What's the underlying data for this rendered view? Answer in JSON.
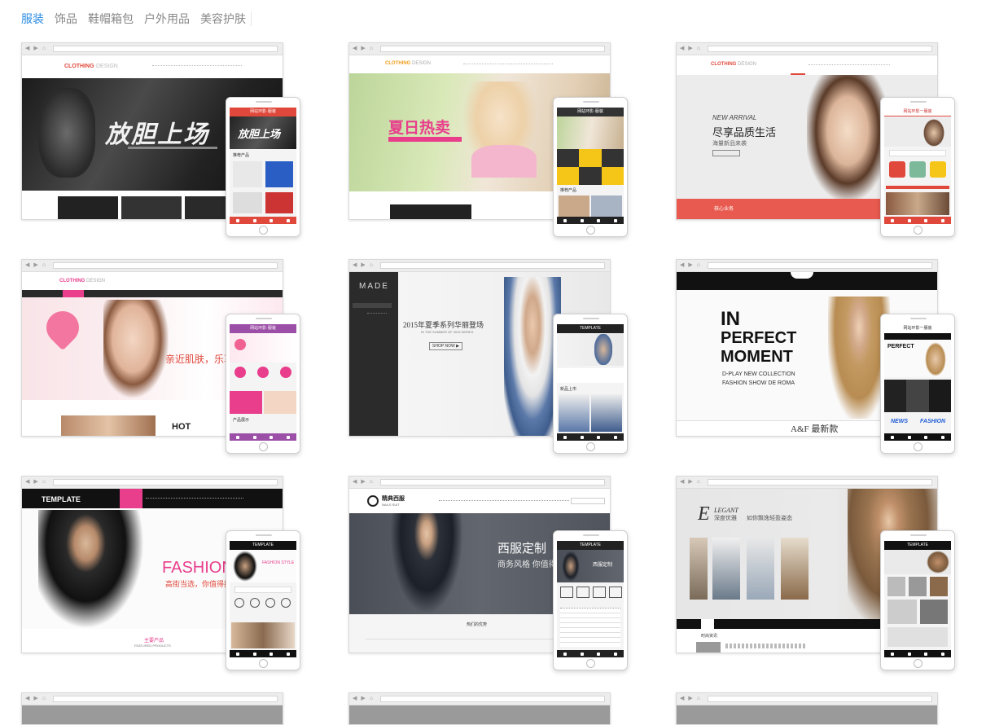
{
  "tabs": [
    "服装",
    "饰品",
    "鞋帽箱包",
    "户外用品",
    "美容护肤"
  ],
  "active_tab": 0,
  "card1": {
    "logo_a": "CLOTHING",
    "logo_b": "DESIGN",
    "hero": "放胆上场",
    "phone_title": "网站环影·服装",
    "phone_section": "推荐产品"
  },
  "card2": {
    "logo_a": "CLOTHING",
    "logo_b": "DESIGN",
    "hero": "夏日热卖",
    "phone_title": "网站环影·服装",
    "phone_section": "推荐产品"
  },
  "card3": {
    "logo_a": "CLOTHING",
    "logo_b": "DESIGN",
    "eyebrow": "NEW ARRIVAL",
    "hero": "尽享品质生活",
    "sub": "海量新品来袭",
    "strip": "核心业务",
    "phone_title": "网站环影一服装"
  },
  "card4": {
    "logo_a": "CLOTHING",
    "logo_b": "DESIGN",
    "hero": "亲近肌肤，乐享",
    "hot": "HOT",
    "phone_title": "网站环影·服装",
    "phone_section": "产品展示"
  },
  "card5": {
    "brand": "MADE",
    "hero": "2015年夏季系列华丽登场",
    "sub": "IN THE SUMMER OF 2015 SERIES",
    "btn": "SHOP NOW ▶",
    "phone_title": "TEMPLATE",
    "phone_section": "新品上市"
  },
  "card6": {
    "line1": "IN",
    "line2": "PERFECT",
    "line3": "MOMENT",
    "sub1": "D-PLAY NEW COLLECTION",
    "sub2": "FASHION SHOW DE ROMA",
    "footer": "A&F 最新款",
    "phone_title": "网站环影一服装",
    "p1": "NEWS",
    "p2": "FASHION"
  },
  "card7": {
    "brand": "TEMPLATE",
    "hero": "FASHION",
    "sub": "高街当选，你值得拥有",
    "foot": "主要产品",
    "foot2": "FEATURED PRODUCTS",
    "phone_title": "TEMPLATE",
    "phone_hero": "FASHION STYLE"
  },
  "card8": {
    "brand": "精典西服",
    "brand_sub": "NAILS SUIT",
    "hero": "西服定制",
    "sub": "商务风格 你值得拥",
    "foot": "热们的优势",
    "phone_title": "TEMPLATE",
    "phone_hero": "西服定制"
  },
  "card9": {
    "mark": "E",
    "brand": "LEGANT",
    "brand_cn": "深度优雅",
    "sub": "如你飘逸轻盈姿态",
    "news": "时尚资讯",
    "phone_title": "TEMPLATE"
  }
}
